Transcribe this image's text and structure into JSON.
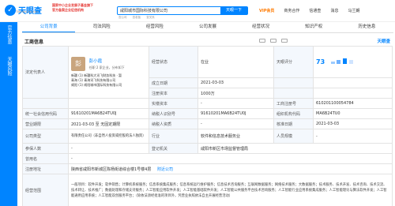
{
  "header": {
    "logo_text": "天眼查",
    "logo_sub": "TianYanCha.com",
    "promo": [
      "国家中小企业发展子基金旗下",
      "官方备案企业征信机构"
    ],
    "search_value": "咸阳城市国际科技有限公司",
    "search_button": "天眼一下",
    "search_tags": [
      "查公司",
      "查老板",
      "查关系"
    ],
    "nav": [
      "VIP会员",
      "商务合作",
      "信通查",
      "消息",
      "马兰朗"
    ]
  },
  "sidebar": {
    "tabs": [
      "官方信息",
      "天眼风险"
    ]
  },
  "tabs": [
    "公司背景",
    "司法风险",
    "经营风险",
    "公司发展",
    "经营状况",
    "知识产权",
    "历史信息"
  ],
  "section": {
    "title": "工商信息",
    "brand": "天眼查"
  },
  "table": {
    "legal_rep_label": "法定代表人",
    "legal_rep_avatar": "彭",
    "legal_rep_name": "彭小霞",
    "legal_rep_role": "任职 2 家企业，分布如下",
    "shares": [
      "新疆 (1) 新疆科大讯飞财务科技 · 暂",
      "青海 (1) 青海讯飞科技有限公司",
      "咸阳 (1) 咸阳城市国际科技有限公司"
    ],
    "status_label": "经营状态",
    "status_value": "在业",
    "score_label": "天眼评分",
    "score_value": "73",
    "found_label": "成立日期",
    "found_value": "2021-03-03",
    "capital_label": "注册资本",
    "capital_value": "1000万",
    "paid_label": "实缴资本",
    "paid_value": "-",
    "reg_no_label": "工商注册号",
    "reg_no_value": "610201100054784",
    "credit_label": "统一社会信用代码",
    "credit_value": "91610201MA6B24TU0J",
    "taxpayer_label": "纳税人识别号",
    "taxpayer_value": "91610201MA6B24TU0J",
    "org_label": "组织机构代码",
    "org_value": "MA6B24TU0",
    "term_label": "营业期限",
    "term_value": "2021-03-03 至 无固定期限",
    "qual_label": "纳税人资质",
    "qual_value": "-",
    "approve_label": "核准日期",
    "approve_value": "2021-03-03",
    "type_label": "公司类型",
    "type_value": "有限责任公司（非自然人投资或控股的法人独资）",
    "industry_label": "行业",
    "industry_value": "软件和信息技术服务业",
    "staff_label": "人员规模",
    "staff_value": "-",
    "insured_label": "参保人数",
    "insured_value": "-",
    "auth_label": "登记机关",
    "auth_value": "咸阳市新区市场监督管理局",
    "former_label": "曾用名",
    "former_value": "-",
    "address_label": "注册地址",
    "address_value": "陕西省咸阳市新城区陈杨街道综合楼1号楼4层",
    "address_link": "附近公司",
    "scope_label": "经营范围",
    "scope_value": "一般项目：软件开发；软件销售；计算机系统服务；信息系统集成服务；信息系统运行维护服务；信息技术咨询服务；互联网数据服务；网络技术服务；大数据服务；技术服务、技术开发、技术咨询、技术交流、技术转让、技术推广；数据处理和存储支持服务；人工智能应用软件开发；人工智能基础软件开发；人工智能公共服务平台技术咨询服务；人工智能行业应用系统集成服务；人工智能理论与算法软件开发；人工智能通用应用系统；人工智能双创服务平台；（除依法须经批准的项目外，凭营业执照依法自主开展经营活动）"
  }
}
